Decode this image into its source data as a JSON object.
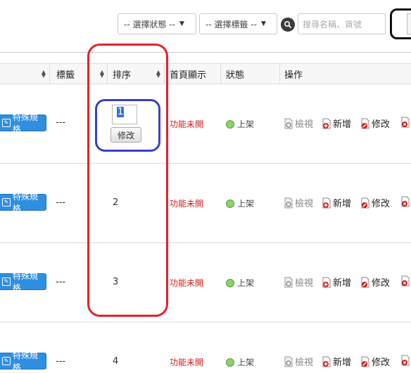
{
  "toolbar": {
    "status_select": "-- 選擇狀態 --",
    "tag_select": "-- 選擇標籤 --",
    "search_placeholder": "搜尋名稱、貨號"
  },
  "table": {
    "headers": [
      "標籤",
      "排序",
      "首頁顯示",
      "狀態",
      "操作"
    ],
    "spec_label": "特殊規格",
    "rows": [
      {
        "tag": "---",
        "sort": "1",
        "homepage": "功能未開",
        "status": "上架"
      },
      {
        "tag": "---",
        "sort": "2",
        "homepage": "功能未開",
        "status": "上架"
      },
      {
        "tag": "---",
        "sort": "3",
        "homepage": "功能未開",
        "status": "上架"
      },
      {
        "tag": "---",
        "sort": "4",
        "homepage": "功能未開",
        "status": "上架"
      }
    ],
    "sort_button": "修改",
    "actions": {
      "view": "檢視",
      "add": "新增",
      "edit": "修改"
    }
  },
  "colors": {
    "primary_button": "#2f8ee0",
    "func_off": "#d02020",
    "status_dot": "#8fd06a",
    "highlight_red": "#e3232e",
    "highlight_blue": "#3a3fc4"
  }
}
